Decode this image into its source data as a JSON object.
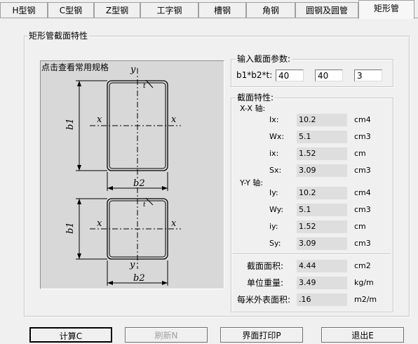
{
  "tabs": [
    "H型钢",
    "C型钢",
    "Z型钢",
    "工字钢",
    "槽钢",
    "角钢",
    "圆钢及圆管",
    "矩形管"
  ],
  "group_title": "矩形管截面特性",
  "drawing": {
    "hint": "点击查看常用规格",
    "sym_y": "y",
    "sym_x": "x",
    "sym_t": "t",
    "sym_b1": "b1",
    "sym_b2": "b2"
  },
  "input_group": {
    "title": "输入截面参数:",
    "label": "b1*b2*t:",
    "b1": "40",
    "b2": "40",
    "t": "3"
  },
  "props": {
    "title": "截面特性:",
    "xx_title": "X-X 轴:",
    "yy_title": "Y-Y 轴:",
    "xx": [
      {
        "label": "Ix:",
        "value": "10.2",
        "unit": "cm4"
      },
      {
        "label": "Wx:",
        "value": "5.1",
        "unit": "cm3"
      },
      {
        "label": "ix:",
        "value": "1.52",
        "unit": "cm"
      },
      {
        "label": "Sx:",
        "value": "3.09",
        "unit": "cm3"
      }
    ],
    "yy": [
      {
        "label": "Iy:",
        "value": "10.2",
        "unit": "cm4"
      },
      {
        "label": "Wy:",
        "value": "5.1",
        "unit": "cm3"
      },
      {
        "label": "iy:",
        "value": "1.52",
        "unit": "cm"
      },
      {
        "label": "Sy:",
        "value": "3.09",
        "unit": "cm3"
      }
    ],
    "area": {
      "label": "截面面积:",
      "value": "4.44",
      "unit": "cm2"
    },
    "weight": {
      "label": "单位重量:",
      "value": "3.49",
      "unit": "kg/m"
    },
    "surface": {
      "label": "每米外表面积:",
      "value": ".16",
      "unit": "m2/m"
    }
  },
  "buttons": {
    "calc": "计算C",
    "refresh": "刷新N",
    "print": "界面打印P",
    "exit": "退出E"
  }
}
